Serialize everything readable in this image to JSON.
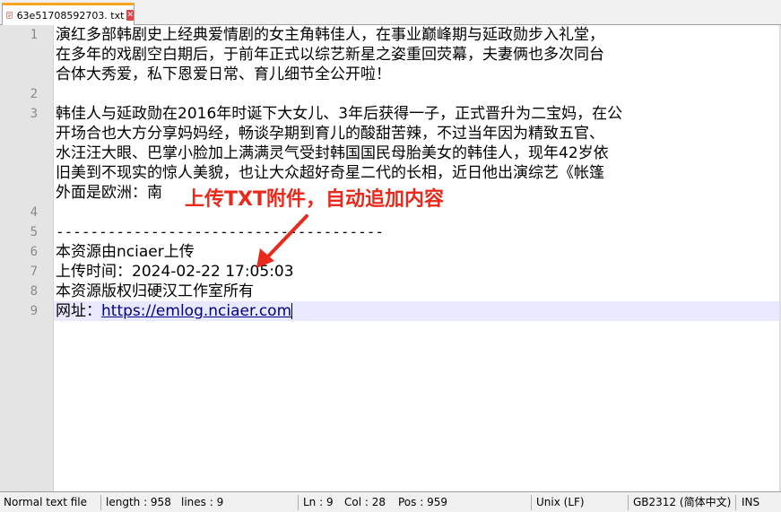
{
  "tab": {
    "filename": "63e51708592703. txt",
    "close_glyph": "✕",
    "accent_color": "#f5a623"
  },
  "editor": {
    "gutter_numbers": [
      "1",
      "",
      "",
      "2",
      "3",
      "",
      "",
      "",
      "",
      "4",
      "5",
      "6",
      "7",
      "8",
      "9"
    ],
    "lines": [
      "演红多部韩剧史上经典爱情剧的女主角韩佳人，在事业巅峰期与延政勋步入礼堂，",
      "在多年的戏剧空白期后，于前年正式以综艺新星之姿重回荧幕，夫妻俩也多次同台",
      "合体大秀爱，私下恩爱日常、育儿细节全公开啦！",
      "",
      "韩佳人与延政勋在2016年时诞下大女儿、3年后获得一子，正式晋升为二宝妈，在公",
      "开场合也大方分享妈妈经，畅谈孕期到育儿的酸甜苦辣，不过当年因为精致五官、",
      "水汪汪大眼、巴掌小脸加上满满灵气受封韩国国民母胎美女的韩佳人，现年42岁依",
      "旧美到不现实的惊人美貌，也让大众超好奇星二代的长相，近日他出演综艺《帐篷",
      "外面是欧洲：南",
      "",
      "--------------------------------------",
      "本资源由nciaer上传",
      "上传时间：2024-02-22 17:05:03",
      "本资源版权归硬汉工作室所有",
      "网址："
    ],
    "url": "https://emlog.nciaer.com",
    "line9_suffix": "（"
  },
  "annotation": {
    "text": "上传TXT附件，自动追加内容",
    "color": "#e8291c"
  },
  "statusbar": {
    "file_type": "Normal text file",
    "length": "length : 958",
    "lines": "lines : 9",
    "ln": "Ln : 9",
    "col": "Col : 28",
    "pos": "Pos : 959",
    "eol": "Unix (LF)",
    "encoding": "GB2312 (简体中文)",
    "mode": "INS"
  }
}
